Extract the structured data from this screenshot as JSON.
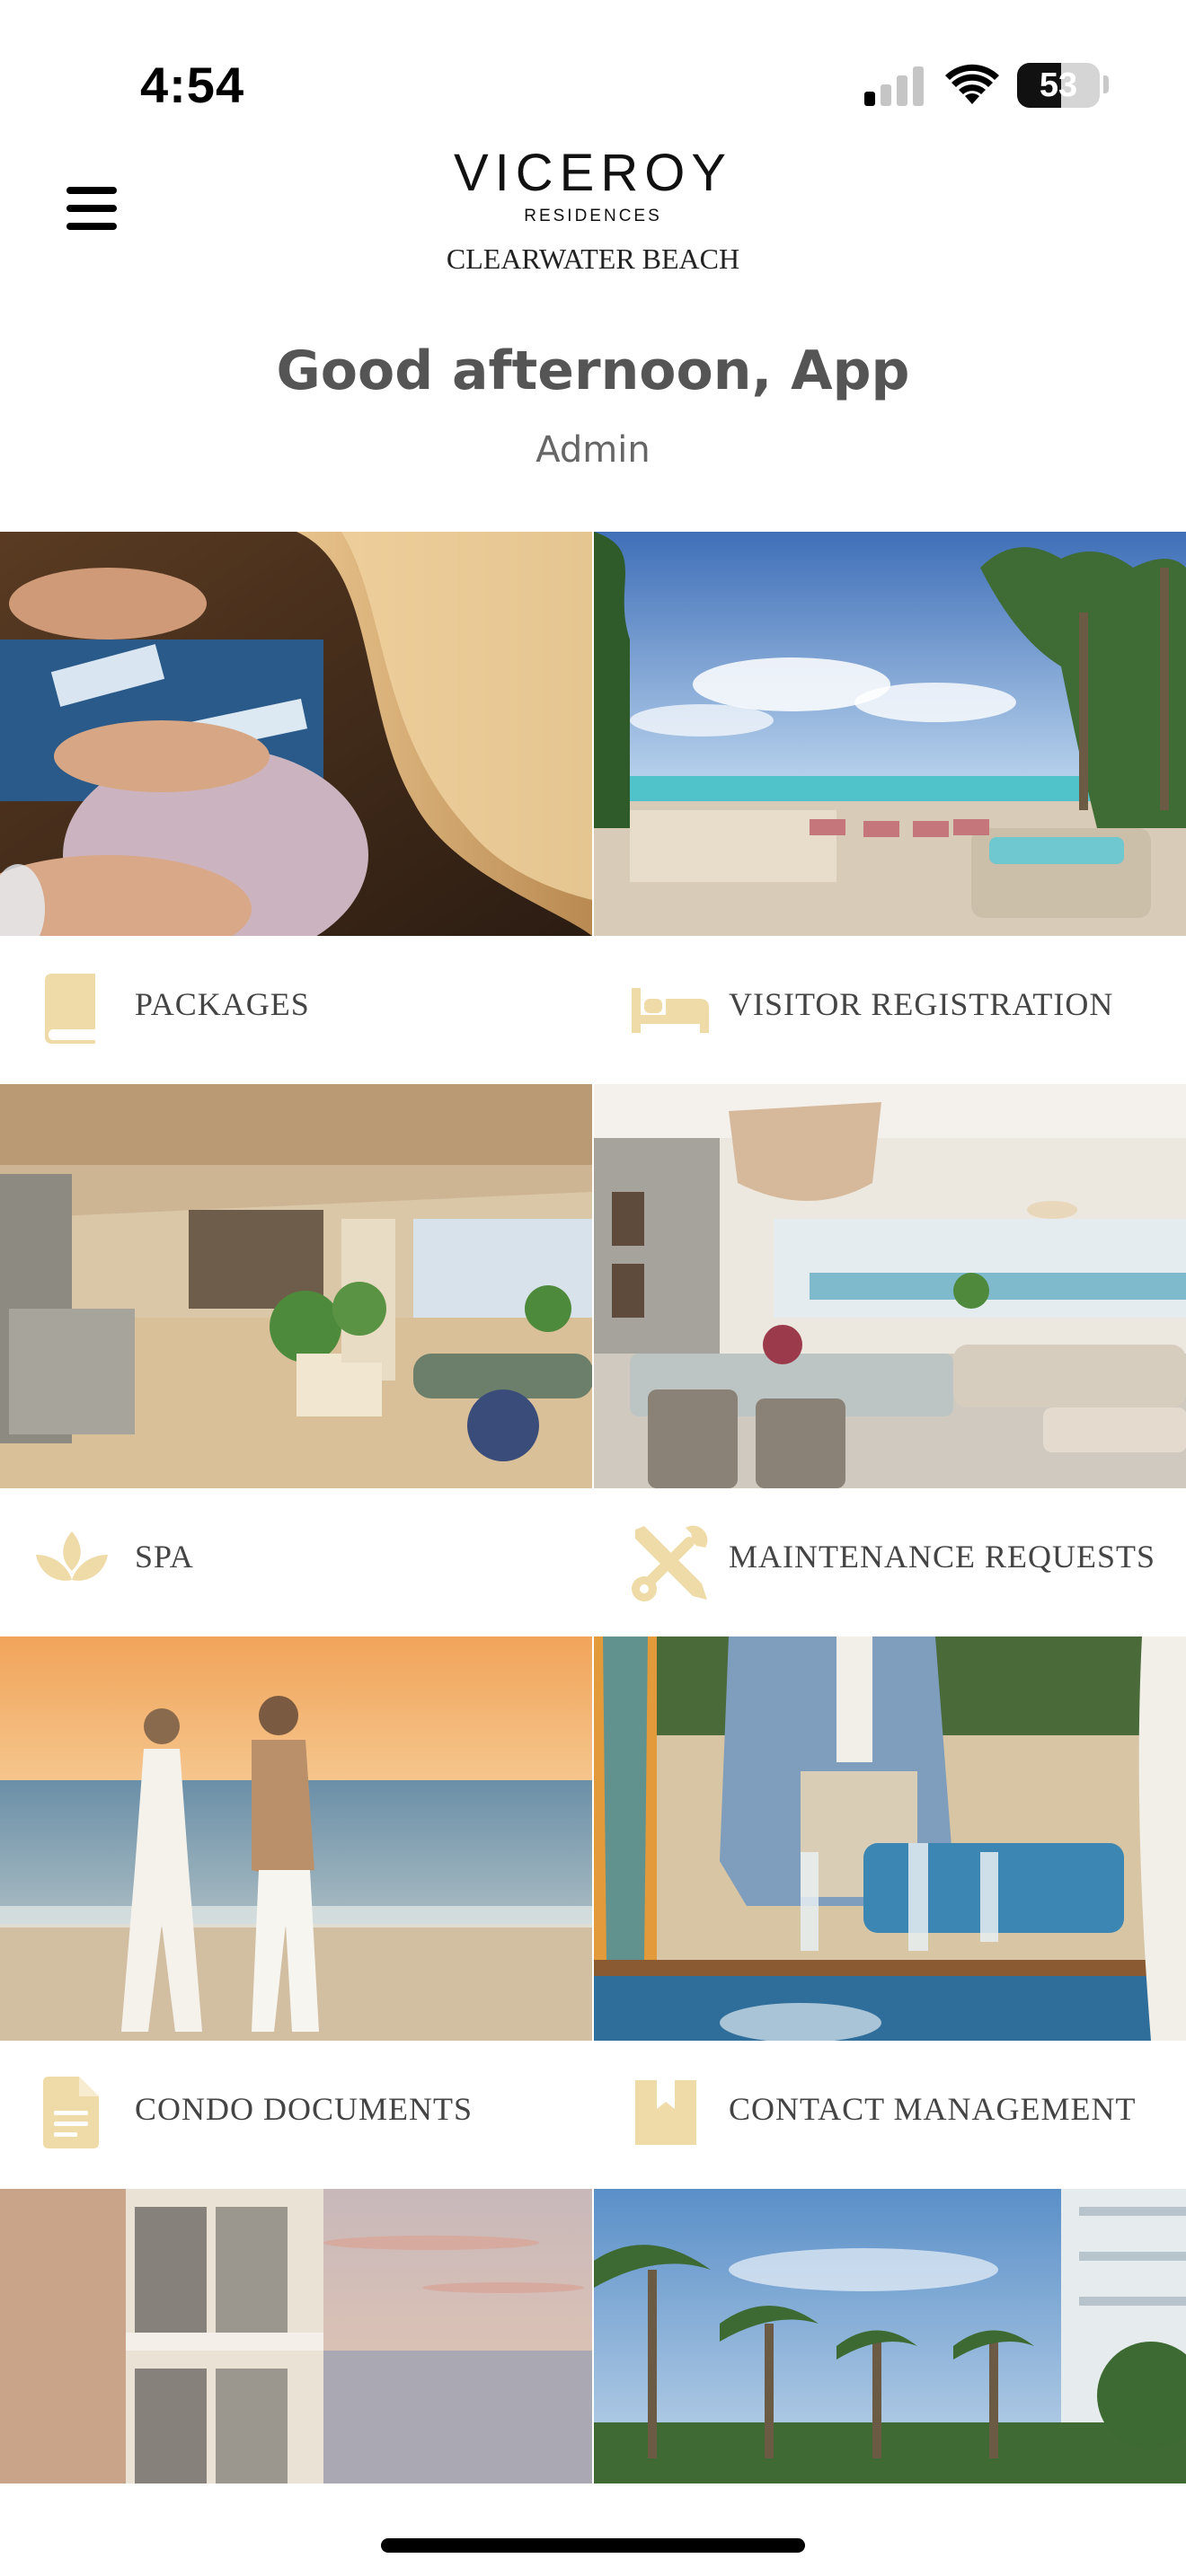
{
  "status_bar": {
    "time": "4:54",
    "battery": "53",
    "battery_level": 0.53
  },
  "header": {
    "logo_main": "VICEROY",
    "logo_sub": "RESIDENCES",
    "logo_location": "CLEARWATER BEACH"
  },
  "greeting": {
    "title": "Good afternoon, App",
    "subtitle": "Admin"
  },
  "tiles": [
    {
      "label": "PACKAGES",
      "icon": "book-icon",
      "image": "hands-with-wine-glass-photo"
    },
    {
      "label": "VISITOR REGISTRATION",
      "icon": "bed-icon",
      "image": "pool-deck-ocean-view-photo"
    },
    {
      "label": "SPA",
      "icon": "lotus-icon",
      "image": "restaurant-lounge-interior-photo"
    },
    {
      "label": "MAINTENANCE REQUESTS",
      "icon": "tools-icon",
      "image": "living-dining-room-photo"
    },
    {
      "label": "CONDO DOCUMENTS",
      "icon": "document-icon",
      "image": "couple-walking-beach-sunset-photo"
    },
    {
      "label": "CONTACT MANAGEMENT",
      "icon": "contacts-book-icon",
      "image": "beach-dinner-table-photo"
    },
    {
      "label": "",
      "icon": "",
      "image": "balcony-sunset-view-photo"
    },
    {
      "label": "",
      "icon": "",
      "image": "palm-trees-tower-photo"
    }
  ],
  "colors": {
    "icon_gold": "#efdba8",
    "label_text": "#444444",
    "greeting_text": "#555555"
  }
}
